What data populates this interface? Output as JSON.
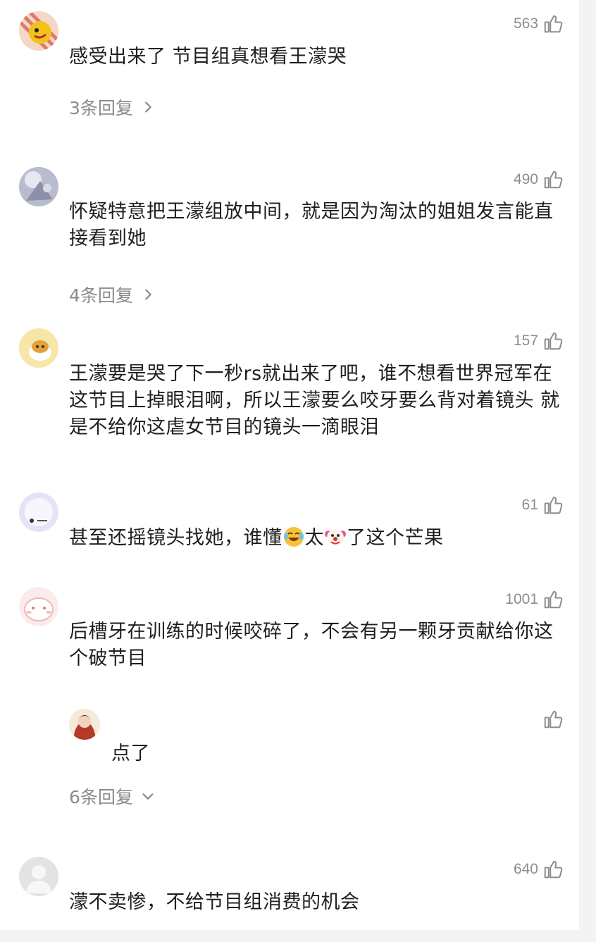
{
  "comments": [
    {
      "likes": "563",
      "text": "感受出来了 节目组真想看王濛哭",
      "replies": "3条回复"
    },
    {
      "likes": "490",
      "text": "怀疑特意把王濛组放中间，就是因为淘汰的姐姐发言能直接看到她",
      "replies": "4条回复"
    },
    {
      "likes": "157",
      "text": "王濛要是哭了下一秒rs就出来了吧，谁不想看世界冠军在这节目上掉眼泪啊，所以王濛要么咬牙要么背对着镜头 就是不给你这虐女节目的镜头一滴眼泪"
    },
    {
      "likes": "61",
      "text_before": "甚至还摇镜头找她，谁懂",
      "emoji1": "laughing-crying-emoji",
      "text_mid": "太",
      "emoji2": "clown-face-emoji",
      "text_after": "了这个芒果"
    },
    {
      "likes": "1001",
      "text": "后槽牙在训练的时候咬碎了，不会有另一颗牙贡献给你这个破节目",
      "sub_reply": {
        "likes": "",
        "text": "点了"
      },
      "replies": "6条回复"
    },
    {
      "likes": "640",
      "text": "濛不卖惨，不给节目组消费的机会"
    }
  ]
}
